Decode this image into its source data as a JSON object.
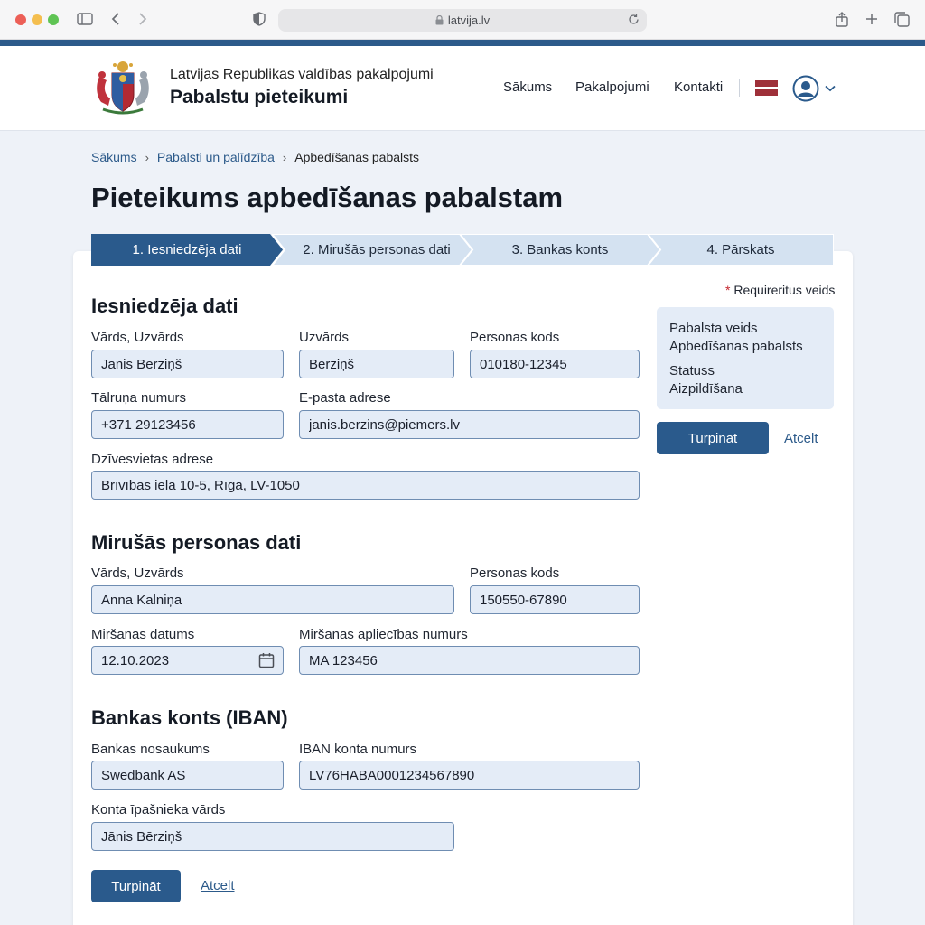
{
  "browser": {
    "url": "latvija.lv",
    "icons": [
      "sidebar-icon",
      "back-icon",
      "forward-icon",
      "shield-icon",
      "lock-icon",
      "reload-icon",
      "share-icon",
      "new-tab-icon",
      "tabs-icon"
    ]
  },
  "header": {
    "subtitle": "Latvijas Republikas valdības pakalpojumi",
    "title": "Pabalstu pieteikumi",
    "nav": [
      "Sākums",
      "Pakalpojumi",
      "Kontakti"
    ],
    "flag_colors": [
      "#9e3039",
      "#ffffff",
      "#9e3039"
    ]
  },
  "breadcrumb": [
    "Sākums",
    "Pabalsti un palīdzība",
    "Apbedīšanas pabalsts"
  ],
  "page_title": "Pieteikums apbedīšanas pabalstam",
  "steps": [
    {
      "label": "1. Iesniedzēja dati",
      "active": true
    },
    {
      "label": "2. Mirušās personas dati",
      "active": false
    },
    {
      "label": "3. Bankas konts",
      "active": false
    },
    {
      "label": "4. Pārskats",
      "active": false
    }
  ],
  "required_note": "Requireritus veids",
  "sections": {
    "applicant": {
      "title": "Iesniedzēja dati",
      "name_label": "Vārds, Uzvārds",
      "name_value": "Jānis Bērziņš",
      "surname_label": "Uzvārds",
      "surname_value": "Bērziņš",
      "personal_code_label": "Personas kods",
      "personal_code_value": "010180-12345",
      "phone_label": "Tālruņa numurs",
      "phone_value": "+371 29123456",
      "email_label": "E-pasta adrese",
      "email_value": "janis.berzins@piemers.lv",
      "address_label": "Dzīvesvietas adrese",
      "address_value": "Brīvības iela 10-5, Rīga, LV-1050"
    },
    "deceased": {
      "title": "Mirušās personas dati",
      "name_label": "Vārds, Uzvārds",
      "name_value": "Anna Kalniņa",
      "personal_code_label": "Personas kods",
      "personal_code_value": "150550-67890",
      "death_date_label": "Miršanas datums",
      "death_date_value": "12.10.2023",
      "certificate_label": "Miršanas apliecības numurs",
      "certificate_value": "MA 123456"
    },
    "bank": {
      "title": "Bankas konts (IBAN)",
      "bank_name_label": "Bankas nosaukums",
      "bank_name_value": "Swedbank AS",
      "iban_label": "IBAN konta numurs",
      "iban_value": "LV76HABA0001234567890",
      "owner_label": "Konta īpašnieka vārds",
      "owner_value": "Jānis Bērziņš"
    }
  },
  "summary": {
    "type_label": "Pabalsta veids",
    "type_value": "Apbedīšanas pabalsts",
    "status_label": "Statuss",
    "status_value": "Aizpildīšana"
  },
  "actions": {
    "continue_label": "Turpināt",
    "cancel_label": "Atcelt"
  },
  "colors": {
    "primary": "#2a5a8c",
    "accent_stripe": "#2c5a8a",
    "input_bg": "#e4ecf7",
    "required_star": "#c4262e"
  }
}
